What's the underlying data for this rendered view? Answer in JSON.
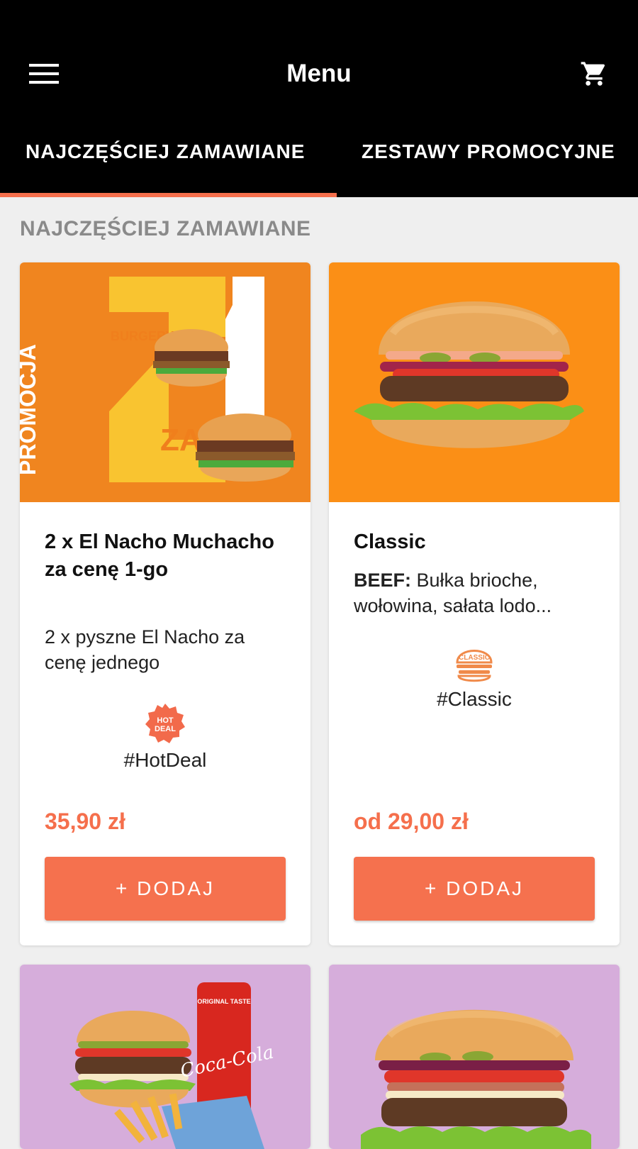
{
  "header": {
    "title": "Menu",
    "menu_icon": "hamburger-menu-icon",
    "cart_icon": "shopping-cart-icon"
  },
  "tabs": [
    {
      "label": "NAJCZĘŚCIEJ ZAMAWIANE",
      "active": true
    },
    {
      "label": "ZESTAWY PROMOCYJNE",
      "active": false
    }
  ],
  "section": {
    "title": "NAJCZĘŚCIEJ ZAMAWIANE"
  },
  "products": [
    {
      "name": "2 x El Nacho Muchacho za cenę 1-go",
      "description": "2 x pyszne El Nacho za cenę jednego",
      "tag_icon_text": "HOT DEAL",
      "tag": "#HotDeal",
      "price": "35,90 zł",
      "add_label": "+ DODAJ",
      "image_text": {
        "side": "PROMOCJA",
        "burgery": "BURGERY",
        "za": "ZA"
      },
      "image_bg": "#f0851f"
    },
    {
      "name": "Classic",
      "description_bold": "BEEF:",
      "description": "Bułka brioche, wołowina, sałata lodo...",
      "tag_icon_text": "CLASSIC",
      "tag": "#Classic",
      "price": "od 29,00 zł",
      "add_label": "+ DODAJ",
      "image_bg": "#fb8f16"
    },
    {
      "image_bg": "#d6addb",
      "can_text": "ORIGINAL TASTE",
      "can_logo": "Coca-Cola"
    },
    {
      "image_bg": "#d6addb"
    }
  ],
  "colors": {
    "accent": "#f56f4c",
    "header_bg": "#000000",
    "page_bg": "#efefef"
  }
}
